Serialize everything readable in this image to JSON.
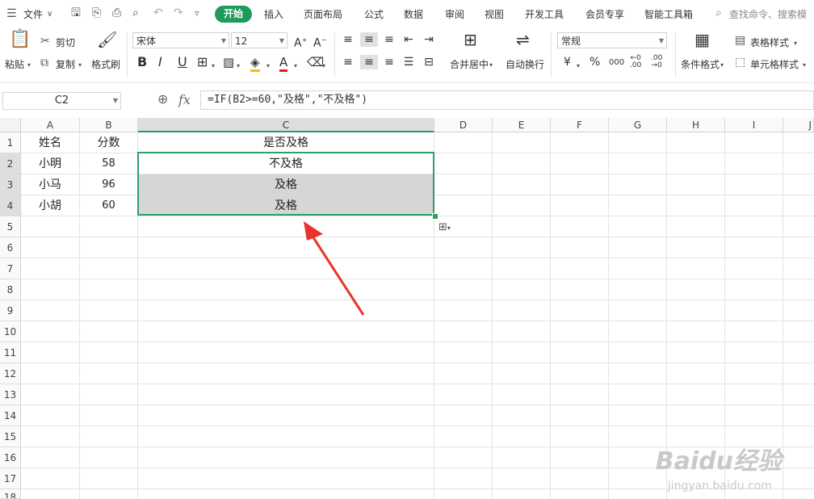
{
  "menubar": {
    "file_label": "文件",
    "tabs": [
      "开始",
      "插入",
      "页面布局",
      "公式",
      "数据",
      "审阅",
      "视图",
      "开发工具",
      "会员专享",
      "智能工具箱"
    ],
    "active_tab": "开始",
    "search_placeholder": "查找命令、搜索模"
  },
  "ribbon": {
    "paste_label": "粘贴",
    "cut_label": "剪切",
    "copy_label": "复制",
    "format_painter_label": "格式刷",
    "font_name": "宋体",
    "font_size": "12",
    "number_format": "常规",
    "merge_label": "合并居中",
    "wrap_label": "自动换行",
    "currency_symbol": "¥",
    "percent_symbol": "%",
    "thousands_symbol": "000",
    "cond_format_label": "条件格式",
    "table_style_label": "表格样式",
    "cell_style_label": "单元格样式"
  },
  "formula_bar": {
    "name_box": "C2",
    "fx_label": "fx",
    "formula": "=IF(B2>=60,\"及格\",\"不及格\")"
  },
  "sheet": {
    "columns": [
      "A",
      "B",
      "C",
      "D",
      "E",
      "F",
      "G",
      "H",
      "I",
      "J"
    ],
    "rows": [
      "1",
      "2",
      "3",
      "4",
      "5",
      "6",
      "7",
      "8",
      "9",
      "10",
      "11",
      "12",
      "13",
      "14",
      "15",
      "16",
      "17",
      "18"
    ],
    "header_row": [
      "姓名",
      "分数",
      "是否及格"
    ],
    "data": [
      [
        "小明",
        "58",
        "不及格"
      ],
      [
        "小马",
        "96",
        "及格"
      ],
      [
        "小胡",
        "60",
        "及格"
      ]
    ],
    "accent_color": "#2e9e66",
    "arrow_color": "#e8352b"
  },
  "watermark": {
    "brand": "Baidu经验",
    "url": "jingyan.baidu.com"
  }
}
